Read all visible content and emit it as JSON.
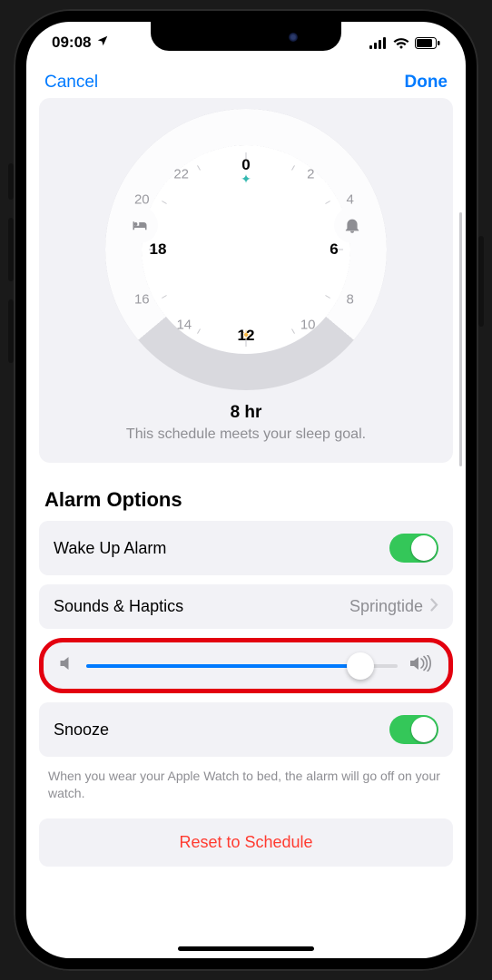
{
  "status": {
    "time": "09:08"
  },
  "nav": {
    "cancel": "Cancel",
    "done": "Done"
  },
  "dial": {
    "hours": [
      "0",
      "2",
      "4",
      "6",
      "8",
      "10",
      "12",
      "14",
      "16",
      "18",
      "20",
      "22"
    ],
    "summary_hours": "8 hr",
    "summary_text": "This schedule meets your sleep goal."
  },
  "alarm": {
    "section_title": "Alarm Options",
    "wake_label": "Wake Up Alarm",
    "wake_on": true,
    "sounds_label": "Sounds & Haptics",
    "sounds_value": "Springtide",
    "volume_percent": 88,
    "snooze_label": "Snooze",
    "snooze_on": true,
    "footnote": "When you wear your Apple Watch to bed, the alarm will go off on your watch.",
    "reset_label": "Reset to Schedule"
  },
  "colors": {
    "accent": "#007aff",
    "green": "#34c759",
    "destructive": "#ff3b30",
    "highlight": "#e3000f"
  }
}
